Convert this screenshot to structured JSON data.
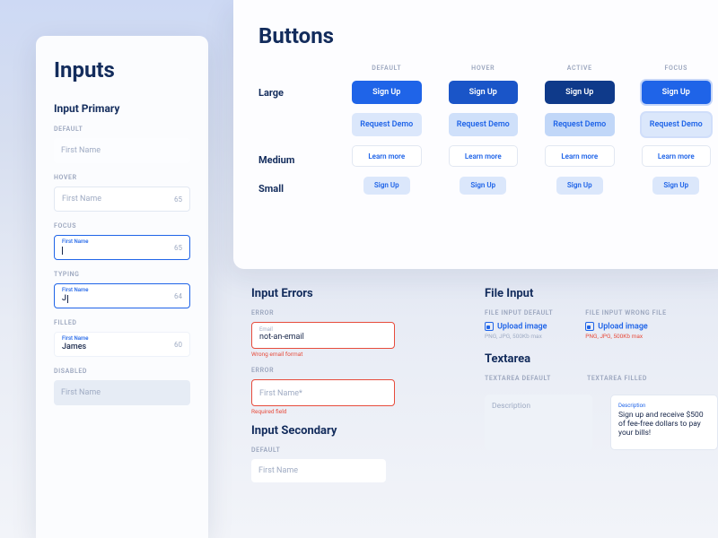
{
  "inputs": {
    "title": "Inputs",
    "primary_heading": "Input Primary",
    "states": {
      "default": "DEFAULT",
      "hover": "HOVER",
      "focus": "FOCUS",
      "typing": "TYPING",
      "filled": "FILLED",
      "disabled": "DISABLED"
    },
    "placeholder": "First Name",
    "float_label": "First Name",
    "typing_value": "J",
    "filled_value": "James",
    "counts": {
      "hover": "65",
      "focus": "65",
      "typing": "64",
      "filled": "60"
    }
  },
  "buttons": {
    "title": "Buttons",
    "cols": [
      "DEFAULT",
      "HOVER",
      "ACTIVE",
      "FOCUS"
    ],
    "rows": {
      "large": "Large",
      "medium": "Medium",
      "small": "Small"
    },
    "primary_label": "Sign Up",
    "light_label": "Request Demo",
    "outline_label": "Learn more",
    "chip_label": "Sign Up"
  },
  "errors": {
    "title": "Input Errors",
    "label": "ERROR",
    "email_float": "Email",
    "email_value": "not-an-email",
    "email_msg": "Wrong email format",
    "name_ph": "First Name*",
    "name_msg": "Required field",
    "secondary_title": "Input Secondary",
    "secondary_label": "DEFAULT",
    "secondary_ph": "First Name"
  },
  "file": {
    "title": "File Input",
    "default_label": "FILE INPUT DEFAULT",
    "wrong_label": "FILE INPUT WRONG FILE",
    "link": "Upload image",
    "hint": "PNG, JPG, 500Kb max"
  },
  "textarea": {
    "title": "Textarea",
    "default_label": "TEXTAREA DEFAULT",
    "filled_label": "TEXTAREA FILLED",
    "placeholder": "Description",
    "float": "Description",
    "filled_text": "Sign up and receive $500 of fee-free dollars to pay your bills!"
  }
}
